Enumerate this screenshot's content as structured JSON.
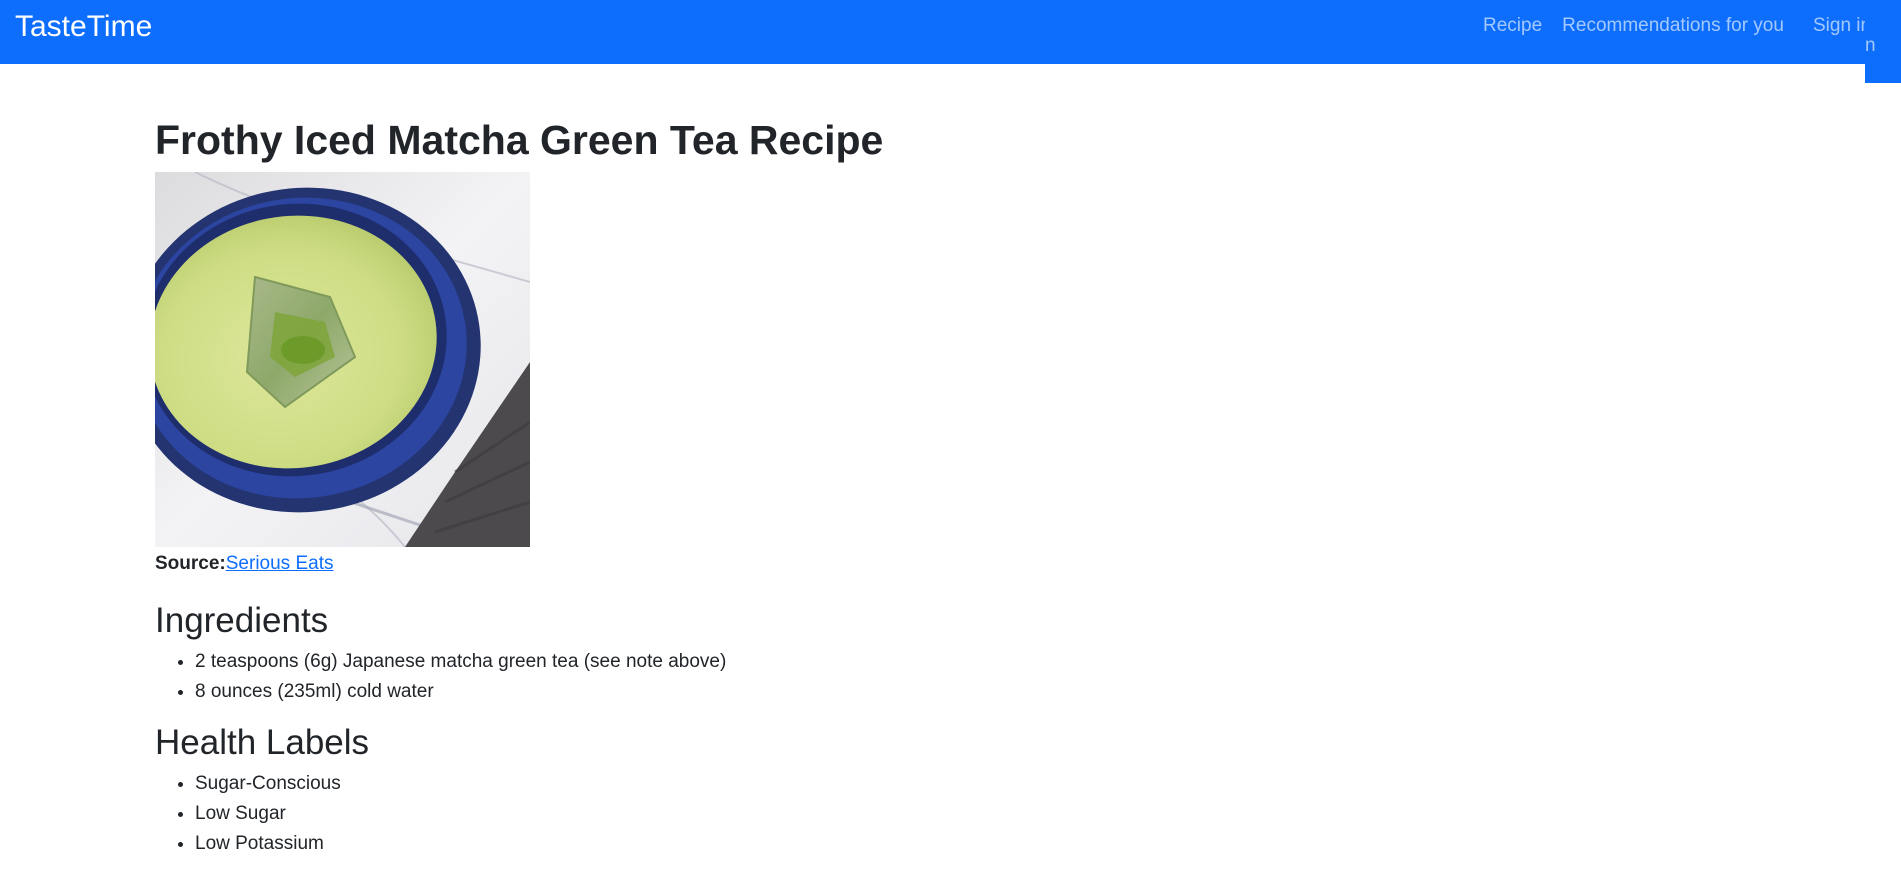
{
  "navbar": {
    "brand": "TasteTime",
    "links": [
      "Recipe",
      "Recommendations for you"
    ],
    "signin_label": "Sign in"
  },
  "recipe": {
    "title": "Frothy Iced Matcha Green Tea Recipe",
    "image_alt": "Frothy iced matcha green tea in a blue bowl",
    "source_label": "Source:",
    "source_name": "Serious Eats"
  },
  "ingredients": {
    "heading": "Ingredients",
    "items": [
      "2 teaspoons (6g) Japanese matcha green tea (see note above)",
      "8 ounces (235ml) cold water"
    ]
  },
  "health_labels": {
    "heading": "Health Labels",
    "items": [
      "Sugar-Conscious",
      "Low Sugar",
      "Low Potassium"
    ]
  },
  "colors": {
    "navbar_bg": "#0d6efd",
    "link": "#0d6efd",
    "text": "#212529"
  }
}
